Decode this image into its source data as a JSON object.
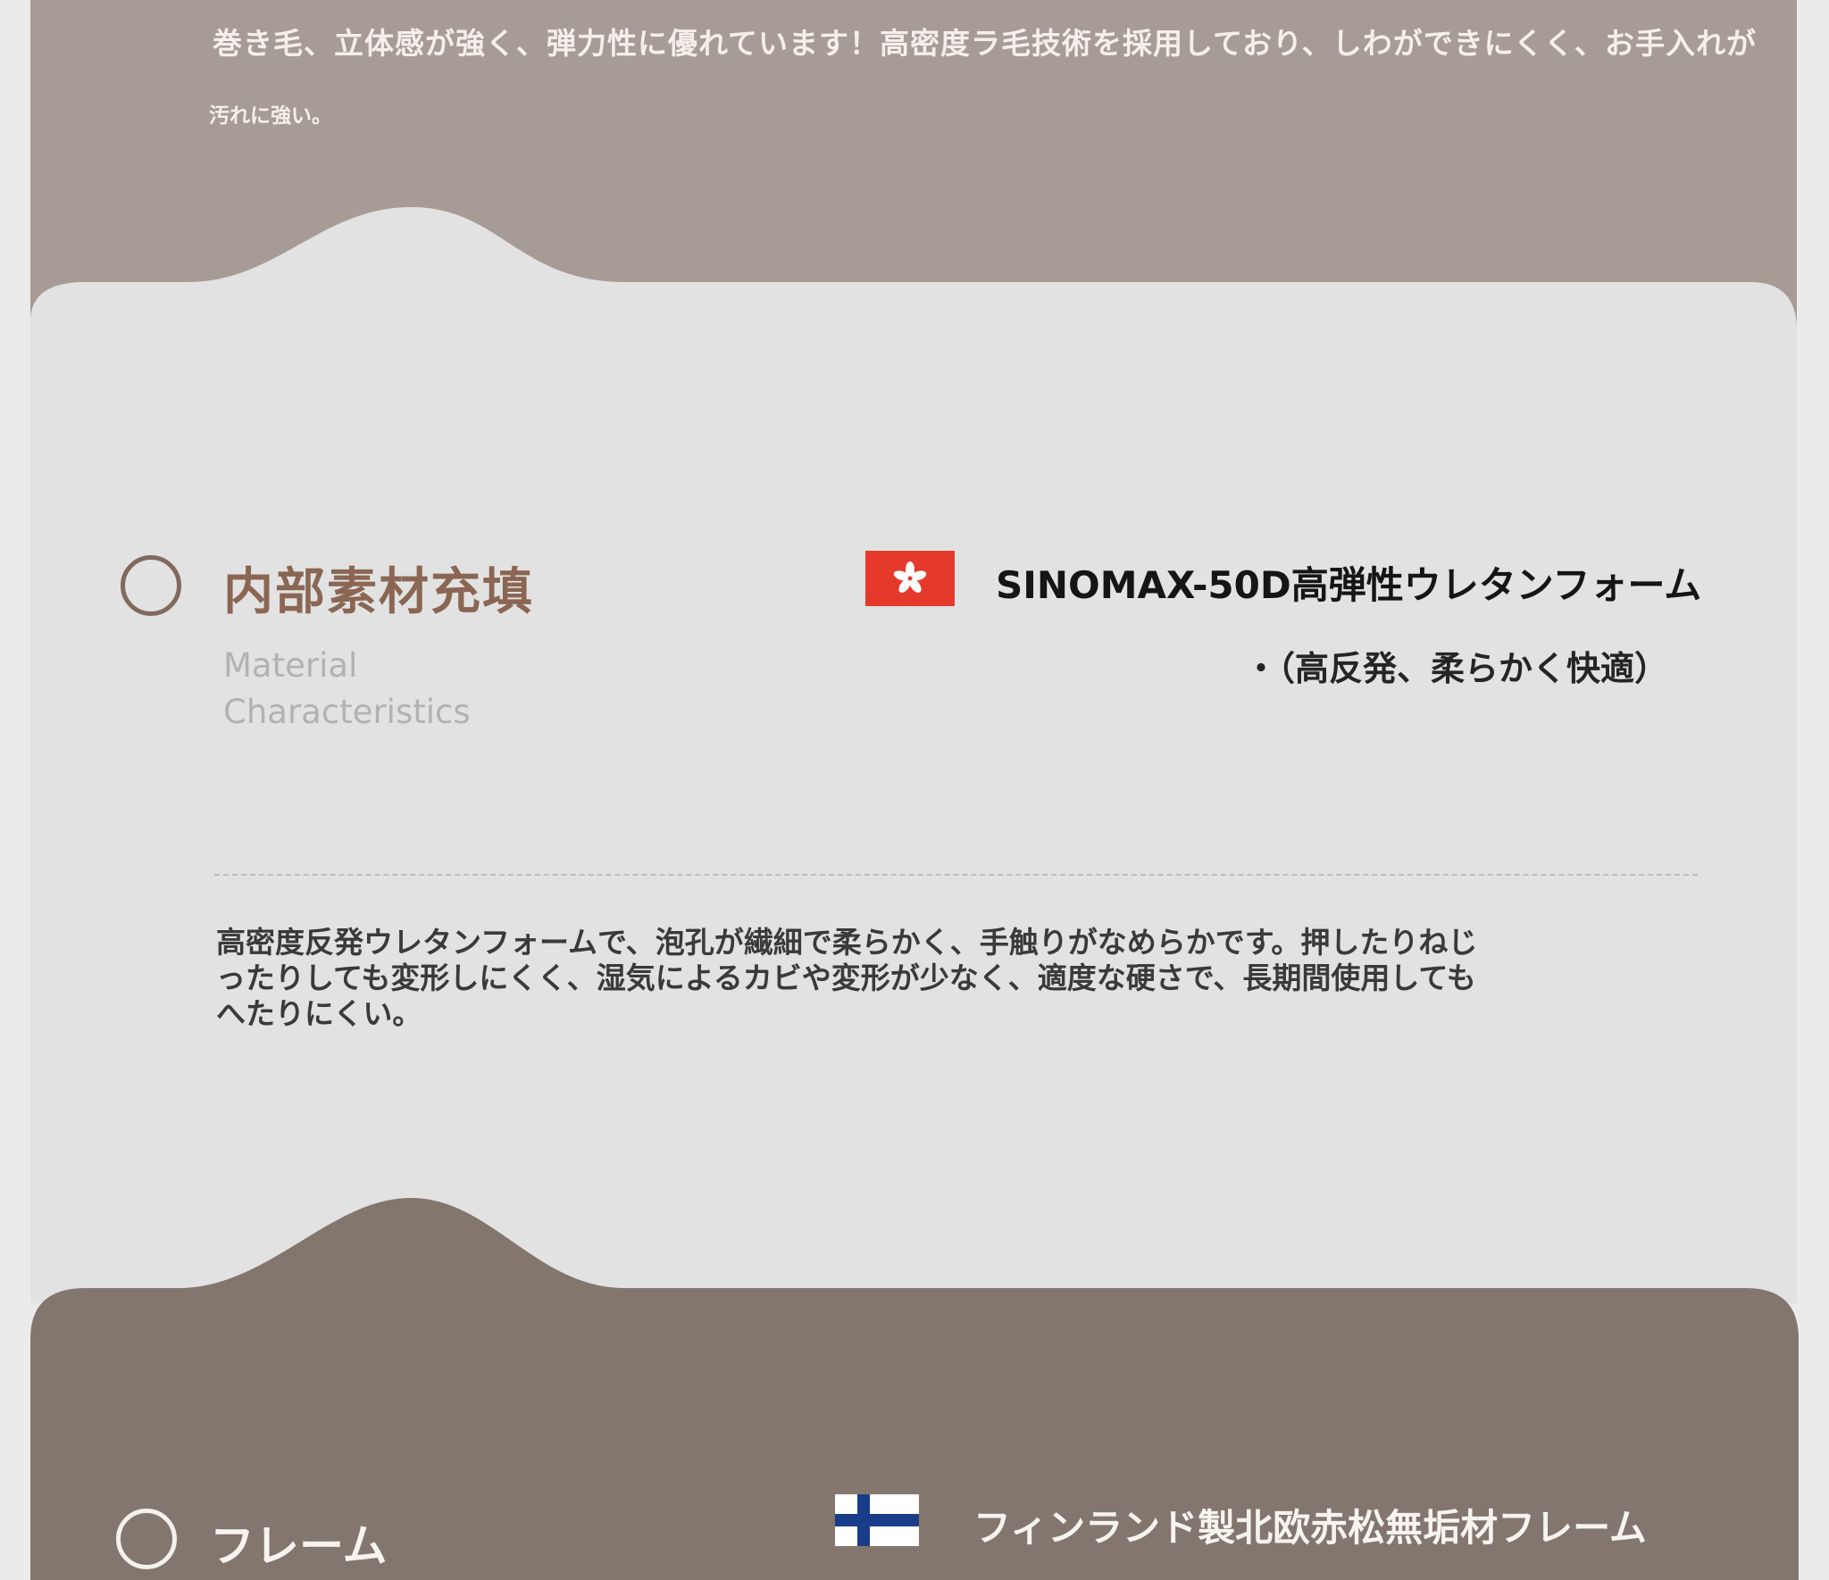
{
  "top_section": {
    "description_line1": "巻き毛、立体感が強く、弾力性に優れています！高密度ラ毛技術を採用しており、しわができにくく、お手入れが",
    "description_line2": "汚れに強い。"
  },
  "material_section": {
    "title": "内部素材充填",
    "subtitle": "Material Characteristics",
    "flag_icon": "hong-kong-flag-icon",
    "product_name": "SINOMAX-50D高弾性ウレタンフォーム",
    "product_note": "・（高反発、柔らかく快適）",
    "description": "高密度反発ウレタンフォームで、泡孔が繊細で柔らかく、手触りがなめらかです。押したりねじったりしても変形しにくく、湿気によるカビや変形が少なく、適度な硬さで、長期間使用してもへたりにくい。"
  },
  "frame_section": {
    "title": "フレーム",
    "flag_icon": "finland-flag-icon",
    "product_name": "フィンランド製北欧赤松無垢材フレーム"
  },
  "colors": {
    "top_band": "#a79c95",
    "light_card": "#e2e2e2",
    "dark_band": "#83766e",
    "accent_brown": "#8a6653",
    "hk_red": "#e5392c",
    "fi_blue": "#1a3d8a"
  }
}
